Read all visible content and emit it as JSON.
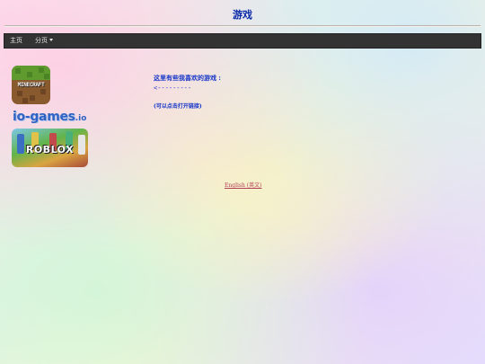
{
  "page": {
    "title": "游戏"
  },
  "nav": {
    "items": [
      {
        "label": "主页",
        "dropdown": false
      },
      {
        "label": "分页",
        "dropdown": true
      }
    ]
  },
  "games": [
    {
      "name": "MINECRAFT",
      "icon": "minecraft-logo"
    },
    {
      "name": "io-games",
      "suffix": ".io",
      "icon": "io-games-logo"
    },
    {
      "name": "ROBLOX",
      "icon": "roblox-logo"
    }
  ],
  "content": {
    "intro": "这里有些我喜欢的游戏 :",
    "arrow": "<---------",
    "hint": "(可以点击打开链接)"
  },
  "footer": {
    "language_link": "English (英文)"
  },
  "colors": {
    "title": "#0a2aa8",
    "navbar": "#333333",
    "text": "#1535c9",
    "link": "#b3405a"
  }
}
